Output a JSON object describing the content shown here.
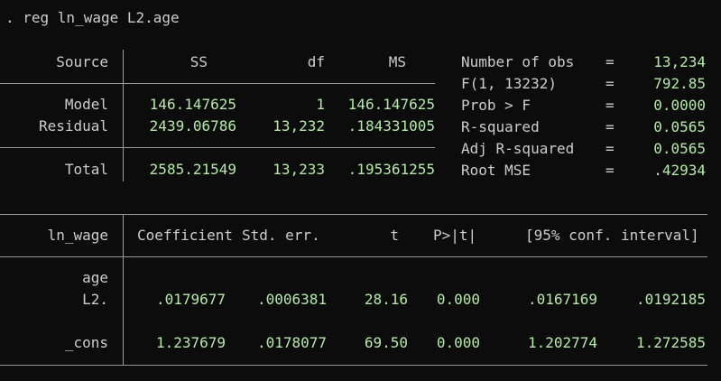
{
  "command": ". reg ln_wage L2.age",
  "anova": {
    "headers": {
      "source": "Source",
      "ss": "SS",
      "df": "df",
      "ms": "MS"
    },
    "rows": [
      {
        "source": "Model",
        "ss": "146.147625",
        "df": "1",
        "ms": "146.147625"
      },
      {
        "source": "Residual",
        "ss": "2439.06786",
        "df": "13,232",
        "ms": ".184331005"
      }
    ],
    "total": {
      "source": "Total",
      "ss": "2585.21549",
      "df": "13,233",
      "ms": ".195361255"
    }
  },
  "stats": [
    {
      "label": "Number of obs",
      "eq": "=",
      "value": "13,234"
    },
    {
      "label": "F(1, 13232)",
      "eq": "=",
      "value": "792.85"
    },
    {
      "label": "Prob > F",
      "eq": "=",
      "value": "0.0000"
    },
    {
      "label": "R-squared",
      "eq": "=",
      "value": "0.0565"
    },
    {
      "label": "Adj R-squared",
      "eq": "=",
      "value": "0.0565"
    },
    {
      "label": "Root MSE",
      "eq": "=",
      "value": ".42934"
    }
  ],
  "coef": {
    "headers": {
      "var": "ln_wage",
      "coef": "Coefficient",
      "se": "Std. err.",
      "t": "t",
      "p": "P>|t|",
      "ci": "[95% conf. interval]"
    },
    "group_label": "age",
    "rows": [
      {
        "var": "L2.",
        "coef": ".0179677",
        "se": ".0006381",
        "t": "28.16",
        "p": "0.000",
        "lo": ".0167169",
        "hi": ".0192185"
      },
      {
        "var": "_cons",
        "coef": "1.237679",
        "se": ".0178077",
        "t": "69.50",
        "p": "0.000",
        "lo": "1.202774",
        "hi": "1.272585"
      }
    ]
  }
}
